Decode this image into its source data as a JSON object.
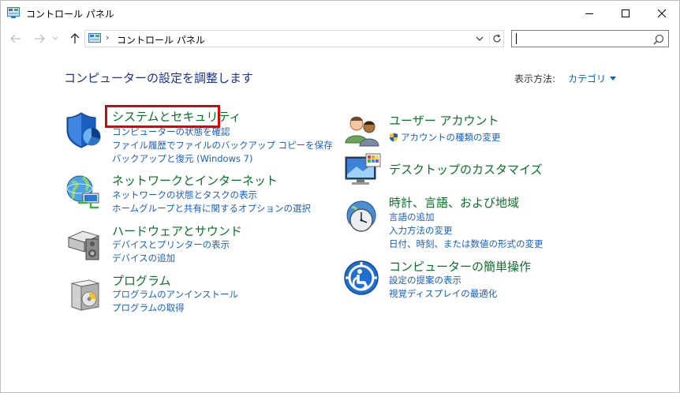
{
  "window": {
    "title": "コントロール パネル"
  },
  "address_bar": {
    "path": "コントロール パネル"
  },
  "search": {
    "value": "",
    "placeholder": ""
  },
  "header": {
    "heading": "コンピューターの設定を調整します",
    "view_label": "表示方法:",
    "view_value": "カテゴリ"
  },
  "categories_left": [
    {
      "title": "システムとセキュリティ",
      "icon": "shield-pie-icon",
      "links": [
        "コンピューターの状態を確認",
        "ファイル履歴でファイルのバックアップ コピーを保存",
        "バックアップと復元 (Windows 7)"
      ]
    },
    {
      "title": "ネットワークとインターネット",
      "icon": "globe-network-icon",
      "links": [
        "ネットワークの状態とタスクの表示",
        "ホームグループと共有に関するオプションの選択"
      ]
    },
    {
      "title": "ハードウェアとサウンド",
      "icon": "printer-speaker-icon",
      "links": [
        "デバイスとプリンターの表示",
        "デバイスの追加"
      ]
    },
    {
      "title": "プログラム",
      "icon": "programs-box-icon",
      "links": [
        "プログラムのアンインストール",
        "プログラムの取得"
      ]
    }
  ],
  "categories_right": [
    {
      "title": "ユーザー アカウント",
      "icon": "user-accounts-icon",
      "links": [
        "アカウントの種類の変更"
      ]
    },
    {
      "title": "デスクトップのカスタマイズ",
      "icon": "monitor-palette-icon",
      "links": []
    },
    {
      "title": "時計、言語、および地域",
      "icon": "clock-globe-icon",
      "links": [
        "言語の追加",
        "入力方法の変更",
        "日付、時刻、または数値の形式の変更"
      ]
    },
    {
      "title": "コンピューターの簡単操作",
      "icon": "ease-of-access-icon",
      "links": [
        "設定の提案の表示",
        "視覚ディスプレイの最適化"
      ]
    }
  ],
  "colors": {
    "category_title": "#0e6f2a",
    "link": "#1a5fc0",
    "heading": "#1e3287",
    "highlight": "#e00000"
  }
}
